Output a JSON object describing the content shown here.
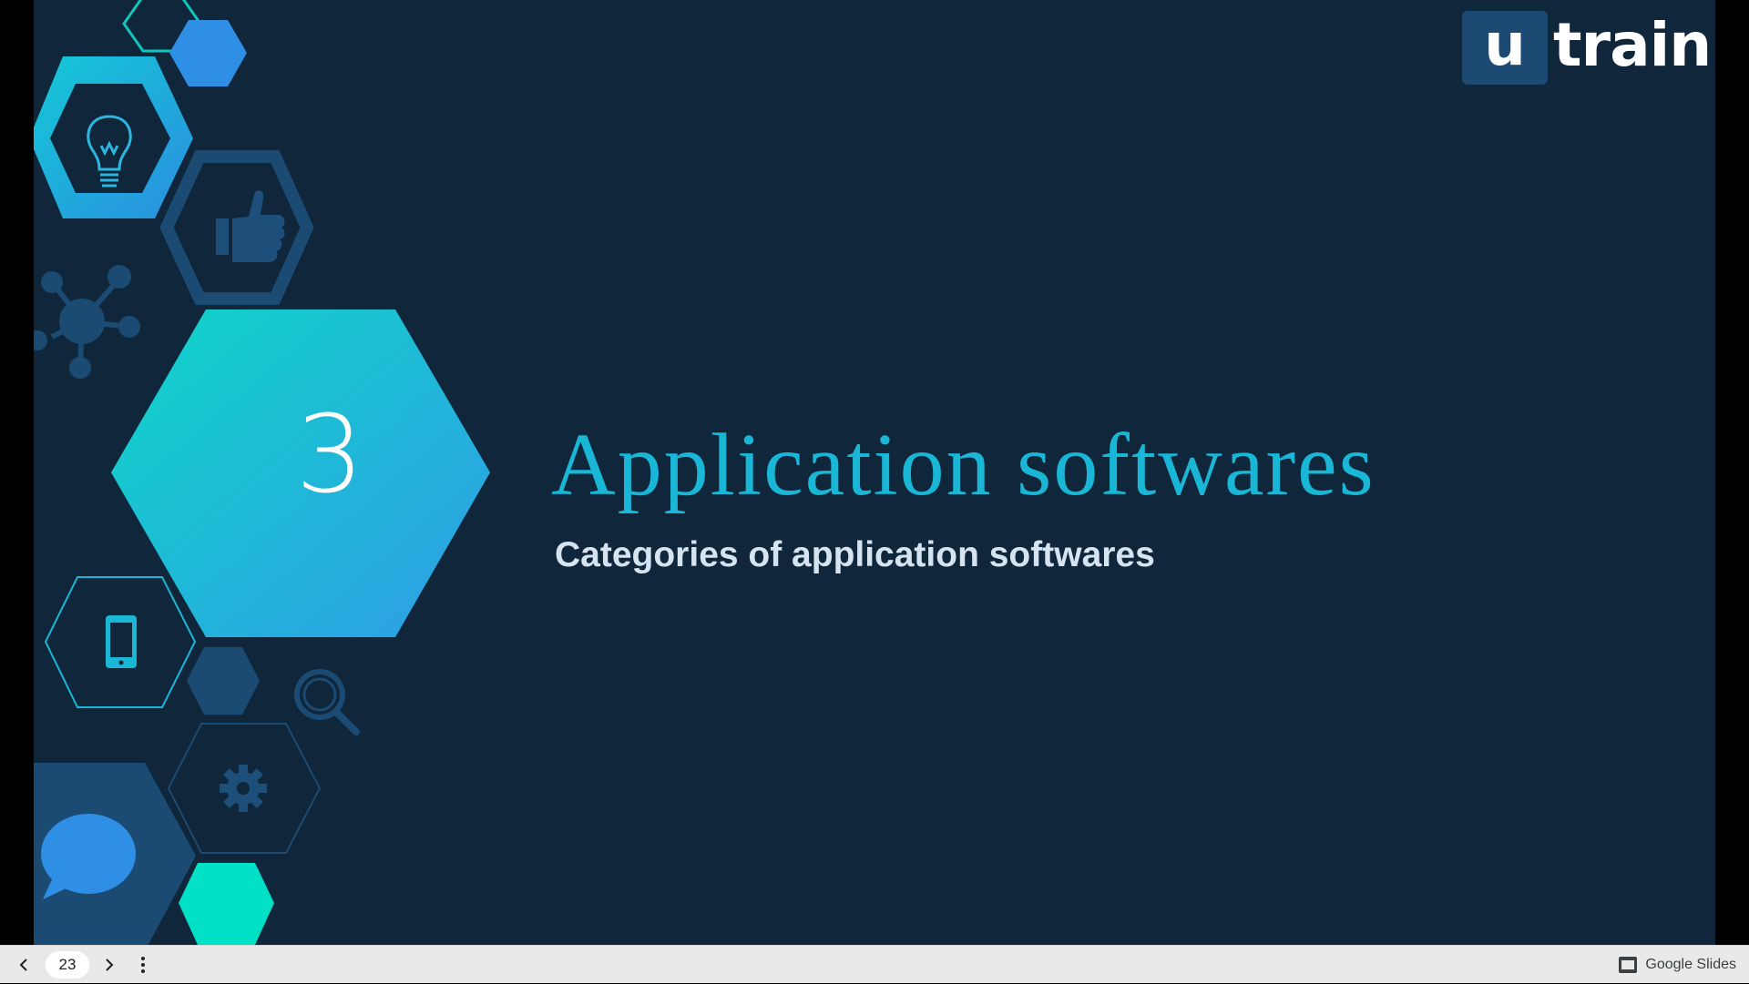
{
  "slide": {
    "section_number": "3",
    "title": "Application softwares",
    "subtitle": "Categories of application softwares",
    "logo": {
      "box_letter": "u",
      "text": "train"
    },
    "colors": {
      "background": "#0f263b",
      "title": "#1ab6d6",
      "subtitle": "#d6e3f1",
      "hex_gradient_start": "#0fd6c8",
      "hex_gradient_end": "#2f9ce6",
      "accent_teal": "#00e0c6",
      "accent_blue": "#2e8fe4",
      "dark_blue": "#1b4a73"
    },
    "decor_icons": [
      "lightbulb-icon",
      "thumbs-up-icon",
      "network-icon",
      "smartphone-icon",
      "magnifier-icon",
      "gear-icon",
      "chat-bubble-icon"
    ]
  },
  "toolbar": {
    "page_number": "23",
    "prev_icon": "chevron-left-icon",
    "next_icon": "chevron-right-icon",
    "more_icon": "more-vert-icon",
    "brand_label": "Google Slides"
  }
}
